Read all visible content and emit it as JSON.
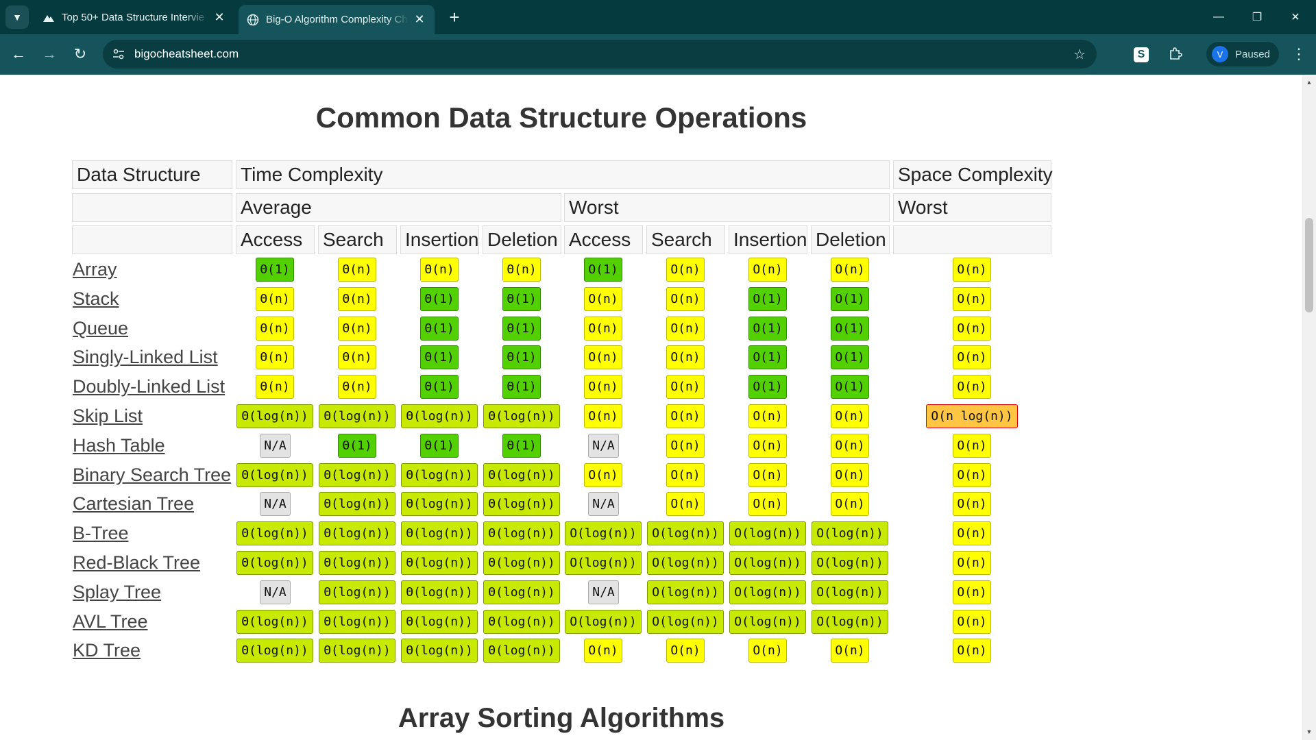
{
  "browser": {
    "tabs": [
      {
        "title": "Top 50+ Data Structure Intervie",
        "active": false
      },
      {
        "title": "Big-O Algorithm Complexity Ch",
        "active": true
      }
    ],
    "url": "bigocheatsheet.com",
    "profile": {
      "initial": "V",
      "status": "Paused"
    }
  },
  "page": {
    "title": "Common Data Structure Operations",
    "next_section_title": "Array Sorting Algorithms",
    "table": {
      "header_row1": {
        "data_structure": "Data Structure",
        "time": "Time Complexity",
        "space": "Space Complexity"
      },
      "header_row2": {
        "average": "Average",
        "worst": "Worst",
        "space_worst": "Worst"
      },
      "op_headers": [
        "Access",
        "Search",
        "Insertion",
        "Deletion",
        "Access",
        "Search",
        "Insertion",
        "Deletion"
      ],
      "rows": [
        {
          "name": "Array",
          "cells": [
            [
              "Θ(1)",
              "good"
            ],
            [
              "Θ(n)",
              "ok"
            ],
            [
              "Θ(n)",
              "ok"
            ],
            [
              "Θ(n)",
              "ok"
            ],
            [
              "O(1)",
              "good"
            ],
            [
              "O(n)",
              "ok"
            ],
            [
              "O(n)",
              "ok"
            ],
            [
              "O(n)",
              "ok"
            ],
            [
              "O(n)",
              "ok"
            ]
          ]
        },
        {
          "name": "Stack",
          "cells": [
            [
              "Θ(n)",
              "ok"
            ],
            [
              "Θ(n)",
              "ok"
            ],
            [
              "Θ(1)",
              "good"
            ],
            [
              "Θ(1)",
              "good"
            ],
            [
              "O(n)",
              "ok"
            ],
            [
              "O(n)",
              "ok"
            ],
            [
              "O(1)",
              "good"
            ],
            [
              "O(1)",
              "good"
            ],
            [
              "O(n)",
              "ok"
            ]
          ]
        },
        {
          "name": "Queue",
          "cells": [
            [
              "Θ(n)",
              "ok"
            ],
            [
              "Θ(n)",
              "ok"
            ],
            [
              "Θ(1)",
              "good"
            ],
            [
              "Θ(1)",
              "good"
            ],
            [
              "O(n)",
              "ok"
            ],
            [
              "O(n)",
              "ok"
            ],
            [
              "O(1)",
              "good"
            ],
            [
              "O(1)",
              "good"
            ],
            [
              "O(n)",
              "ok"
            ]
          ]
        },
        {
          "name": "Singly-Linked List",
          "cells": [
            [
              "Θ(n)",
              "ok"
            ],
            [
              "Θ(n)",
              "ok"
            ],
            [
              "Θ(1)",
              "good"
            ],
            [
              "Θ(1)",
              "good"
            ],
            [
              "O(n)",
              "ok"
            ],
            [
              "O(n)",
              "ok"
            ],
            [
              "O(1)",
              "good"
            ],
            [
              "O(1)",
              "good"
            ],
            [
              "O(n)",
              "ok"
            ]
          ]
        },
        {
          "name": "Doubly-Linked List",
          "cells": [
            [
              "Θ(n)",
              "ok"
            ],
            [
              "Θ(n)",
              "ok"
            ],
            [
              "Θ(1)",
              "good"
            ],
            [
              "Θ(1)",
              "good"
            ],
            [
              "O(n)",
              "ok"
            ],
            [
              "O(n)",
              "ok"
            ],
            [
              "O(1)",
              "good"
            ],
            [
              "O(1)",
              "good"
            ],
            [
              "O(n)",
              "ok"
            ]
          ]
        },
        {
          "name": "Skip List",
          "cells": [
            [
              "Θ(log(n))",
              "fair"
            ],
            [
              "Θ(log(n))",
              "fair"
            ],
            [
              "Θ(log(n))",
              "fair"
            ],
            [
              "Θ(log(n))",
              "fair"
            ],
            [
              "O(n)",
              "ok"
            ],
            [
              "O(n)",
              "ok"
            ],
            [
              "O(n)",
              "ok"
            ],
            [
              "O(n)",
              "ok"
            ],
            [
              "O(n log(n))",
              "bad"
            ]
          ]
        },
        {
          "name": "Hash Table",
          "cells": [
            [
              "N/A",
              "na"
            ],
            [
              "Θ(1)",
              "good"
            ],
            [
              "Θ(1)",
              "good"
            ],
            [
              "Θ(1)",
              "good"
            ],
            [
              "N/A",
              "na"
            ],
            [
              "O(n)",
              "ok"
            ],
            [
              "O(n)",
              "ok"
            ],
            [
              "O(n)",
              "ok"
            ],
            [
              "O(n)",
              "ok"
            ]
          ]
        },
        {
          "name": "Binary Search Tree",
          "cells": [
            [
              "Θ(log(n))",
              "fair"
            ],
            [
              "Θ(log(n))",
              "fair"
            ],
            [
              "Θ(log(n))",
              "fair"
            ],
            [
              "Θ(log(n))",
              "fair"
            ],
            [
              "O(n)",
              "ok"
            ],
            [
              "O(n)",
              "ok"
            ],
            [
              "O(n)",
              "ok"
            ],
            [
              "O(n)",
              "ok"
            ],
            [
              "O(n)",
              "ok"
            ]
          ]
        },
        {
          "name": "Cartesian Tree",
          "cells": [
            [
              "N/A",
              "na"
            ],
            [
              "Θ(log(n))",
              "fair"
            ],
            [
              "Θ(log(n))",
              "fair"
            ],
            [
              "Θ(log(n))",
              "fair"
            ],
            [
              "N/A",
              "na"
            ],
            [
              "O(n)",
              "ok"
            ],
            [
              "O(n)",
              "ok"
            ],
            [
              "O(n)",
              "ok"
            ],
            [
              "O(n)",
              "ok"
            ]
          ]
        },
        {
          "name": "B-Tree",
          "cells": [
            [
              "Θ(log(n))",
              "fair"
            ],
            [
              "Θ(log(n))",
              "fair"
            ],
            [
              "Θ(log(n))",
              "fair"
            ],
            [
              "Θ(log(n))",
              "fair"
            ],
            [
              "O(log(n))",
              "fair"
            ],
            [
              "O(log(n))",
              "fair"
            ],
            [
              "O(log(n))",
              "fair"
            ],
            [
              "O(log(n))",
              "fair"
            ],
            [
              "O(n)",
              "ok"
            ]
          ]
        },
        {
          "name": "Red-Black Tree",
          "cells": [
            [
              "Θ(log(n))",
              "fair"
            ],
            [
              "Θ(log(n))",
              "fair"
            ],
            [
              "Θ(log(n))",
              "fair"
            ],
            [
              "Θ(log(n))",
              "fair"
            ],
            [
              "O(log(n))",
              "fair"
            ],
            [
              "O(log(n))",
              "fair"
            ],
            [
              "O(log(n))",
              "fair"
            ],
            [
              "O(log(n))",
              "fair"
            ],
            [
              "O(n)",
              "ok"
            ]
          ]
        },
        {
          "name": "Splay Tree",
          "cells": [
            [
              "N/A",
              "na"
            ],
            [
              "Θ(log(n))",
              "fair"
            ],
            [
              "Θ(log(n))",
              "fair"
            ],
            [
              "Θ(log(n))",
              "fair"
            ],
            [
              "N/A",
              "na"
            ],
            [
              "O(log(n))",
              "fair"
            ],
            [
              "O(log(n))",
              "fair"
            ],
            [
              "O(log(n))",
              "fair"
            ],
            [
              "O(n)",
              "ok"
            ]
          ]
        },
        {
          "name": "AVL Tree",
          "cells": [
            [
              "Θ(log(n))",
              "fair"
            ],
            [
              "Θ(log(n))",
              "fair"
            ],
            [
              "Θ(log(n))",
              "fair"
            ],
            [
              "Θ(log(n))",
              "fair"
            ],
            [
              "O(log(n))",
              "fair"
            ],
            [
              "O(log(n))",
              "fair"
            ],
            [
              "O(log(n))",
              "fair"
            ],
            [
              "O(log(n))",
              "fair"
            ],
            [
              "O(n)",
              "ok"
            ]
          ]
        },
        {
          "name": "KD Tree",
          "cells": [
            [
              "Θ(log(n))",
              "fair"
            ],
            [
              "Θ(log(n))",
              "fair"
            ],
            [
              "Θ(log(n))",
              "fair"
            ],
            [
              "Θ(log(n))",
              "fair"
            ],
            [
              "O(n)",
              "ok"
            ],
            [
              "O(n)",
              "ok"
            ],
            [
              "O(n)",
              "ok"
            ],
            [
              "O(n)",
              "ok"
            ],
            [
              "O(n)",
              "ok"
            ]
          ]
        }
      ]
    }
  }
}
